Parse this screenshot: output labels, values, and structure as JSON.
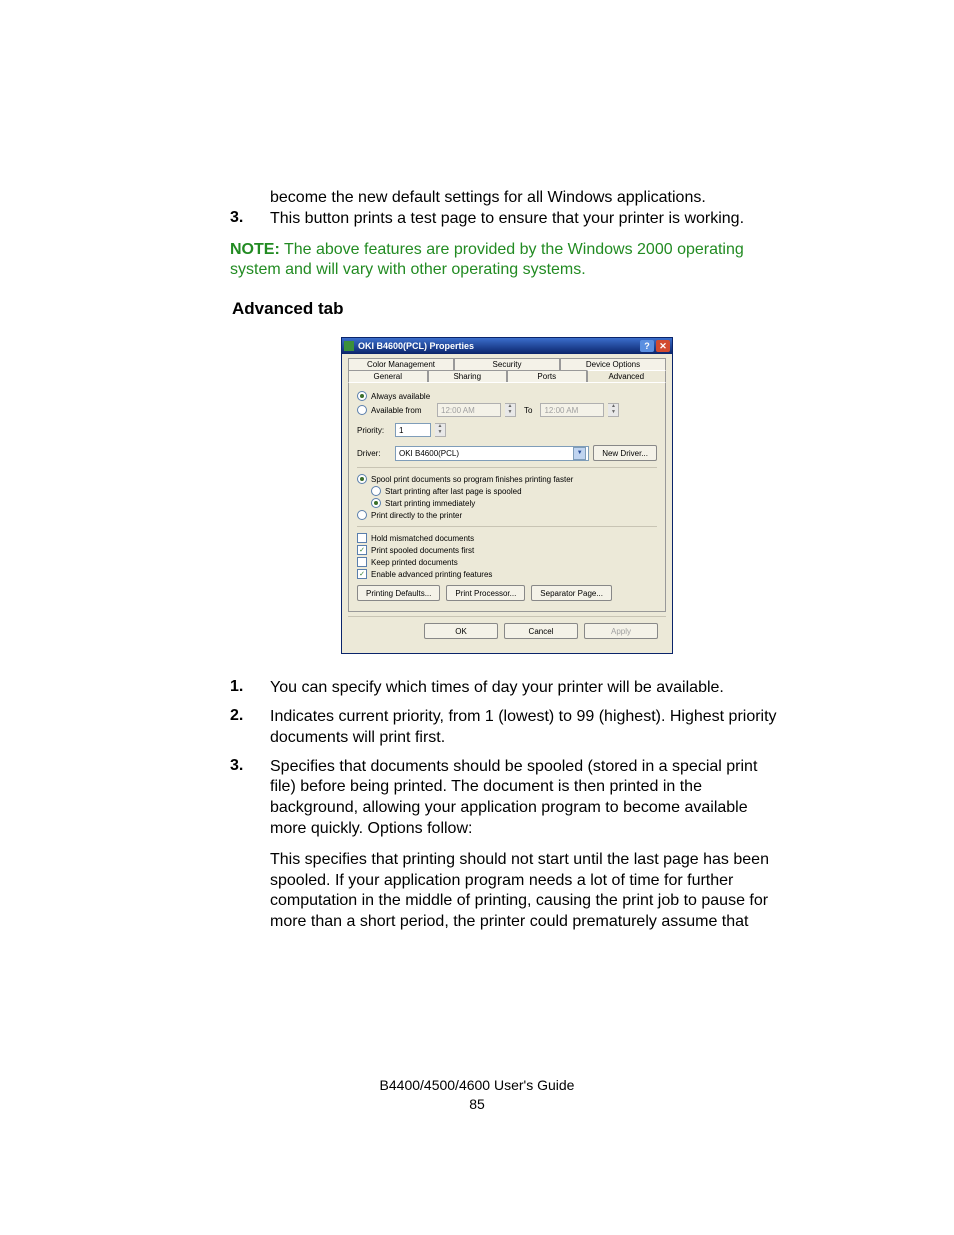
{
  "intro_partial": "become the new default settings for all Windows applications.",
  "pre_item": {
    "num": "3.",
    "text": "This button prints a test page to ensure that your printer is working."
  },
  "note": {
    "label": "NOTE:",
    "text": " The above features are provided by the Windows 2000 operating system and will vary with other operating systems."
  },
  "heading": "Advanced tab",
  "dialog": {
    "title": "OKI B4600(PCL) Properties",
    "help": "?",
    "close": "✕",
    "tabs_row1": [
      "Color Management",
      "Security",
      "Device Options"
    ],
    "tabs_row2": [
      "General",
      "Sharing",
      "Ports",
      "Advanced"
    ],
    "avail_always": "Always available",
    "avail_from": "Available from",
    "time": "12:00 AM",
    "to": "To",
    "priority_label": "Priority:",
    "priority_value": "1",
    "driver_label": "Driver:",
    "driver_value": "OKI B4600(PCL)",
    "new_driver": "New Driver...",
    "spool": "Spool print documents so program finishes printing faster",
    "spool_after": "Start printing after last page is spooled",
    "spool_immediate": "Start printing immediately",
    "print_direct": "Print directly to the printer",
    "hold": "Hold mismatched documents",
    "spooled_first": "Print spooled documents first",
    "keep": "Keep printed documents",
    "enable_adv": "Enable advanced printing features",
    "printing_defaults": "Printing Defaults...",
    "print_processor": "Print Processor...",
    "separator_page": "Separator Page...",
    "ok": "OK",
    "cancel": "Cancel",
    "apply": "Apply"
  },
  "items": [
    {
      "num": "1.",
      "text": " You can specify which times of day your printer will be available."
    },
    {
      "num": "2.",
      "text": "Indicates current priority, from 1 (lowest) to 99 (highest). Highest priority documents will print first."
    },
    {
      "num": "3.",
      "text": "Specifies that documents should be spooled (stored in a special print file) before being printed. The document is then printed in the background, allowing your application program to become available more quickly. Options follow:",
      "extra": "This specifies that printing should not start until the last page has been spooled. If your application program needs a lot of time for further computation in the middle of printing, causing the print job to pause for more than a short period, the printer could prematurely assume that"
    }
  ],
  "footer": {
    "line1": "B4400/4500/4600 User's Guide",
    "line2": "85"
  }
}
